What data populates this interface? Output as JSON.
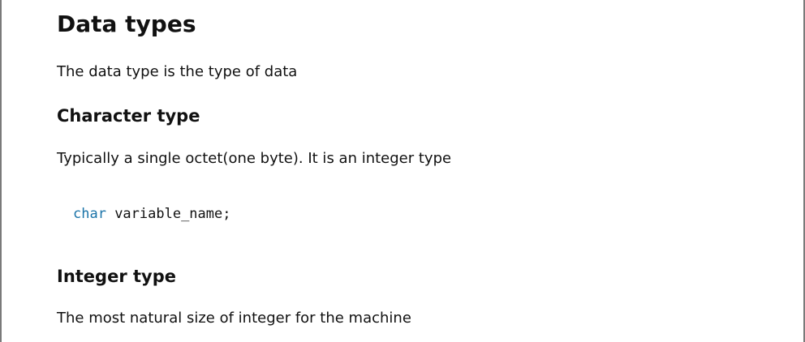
{
  "doc": {
    "title": "Data types",
    "intro": "The data type is the type of data",
    "sections": [
      {
        "heading": "Character type",
        "text": "Typically a single octet(one byte). It is an integer type",
        "code": {
          "keyword": "char",
          "rest": " variable_name;"
        }
      },
      {
        "heading": "Integer type",
        "text": "The most natural size of integer for the machine"
      }
    ]
  },
  "colors": {
    "keyword": "#1a73a8",
    "text": "#111111",
    "border": "#7a7a7a"
  }
}
